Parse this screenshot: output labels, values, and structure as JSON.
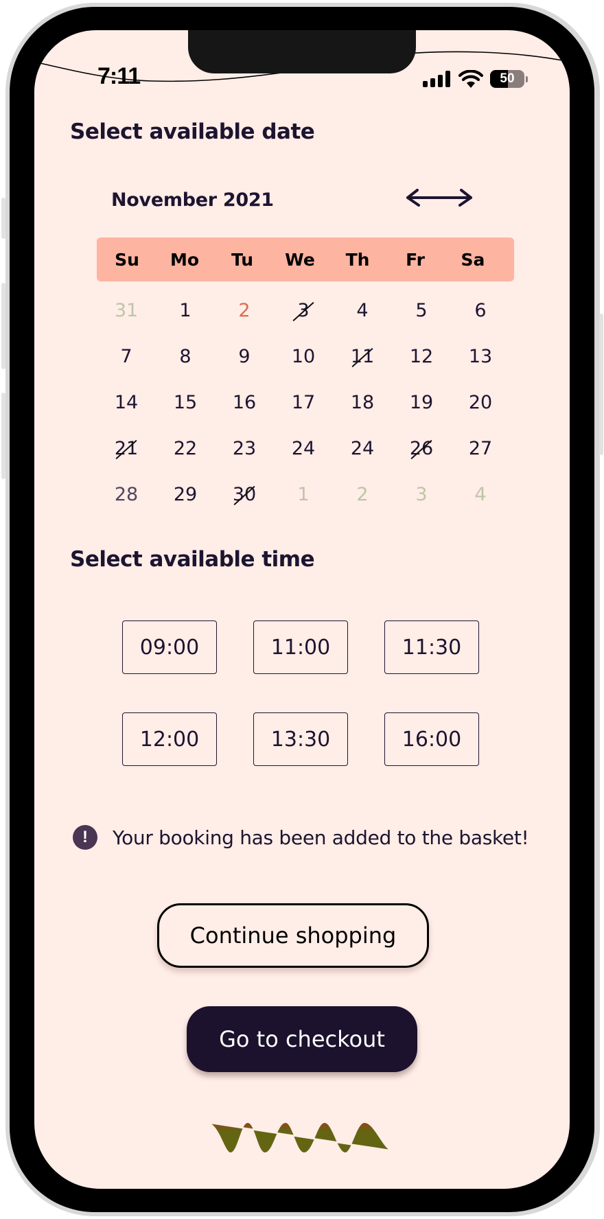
{
  "status_bar": {
    "time": "7:11",
    "battery_level": "50",
    "signal_icon": "cellular-signal-icon",
    "wifi_icon": "wifi-icon"
  },
  "date_section": {
    "title": "Select available date",
    "month_label": "November 2021",
    "nav_icon": "left-right-arrow-icon",
    "weekdays": [
      "Su",
      "Mo",
      "Tu",
      "We",
      "Th",
      "Fr",
      "Sa"
    ],
    "weeks": [
      [
        {
          "label": "31",
          "state": "muted"
        },
        {
          "label": "1",
          "state": "normal"
        },
        {
          "label": "2",
          "state": "today"
        },
        {
          "label": "3",
          "state": "unavailable"
        },
        {
          "label": "4",
          "state": "normal"
        },
        {
          "label": "5",
          "state": "normal"
        },
        {
          "label": "6",
          "state": "normal"
        }
      ],
      [
        {
          "label": "7",
          "state": "normal"
        },
        {
          "label": "8",
          "state": "normal"
        },
        {
          "label": "9",
          "state": "normal"
        },
        {
          "label": "10",
          "state": "normal"
        },
        {
          "label": "11",
          "state": "unavailable"
        },
        {
          "label": "12",
          "state": "normal"
        },
        {
          "label": "13",
          "state": "normal"
        }
      ],
      [
        {
          "label": "14",
          "state": "normal"
        },
        {
          "label": "15",
          "state": "normal"
        },
        {
          "label": "16",
          "state": "normal"
        },
        {
          "label": "17",
          "state": "normal"
        },
        {
          "label": "18",
          "state": "normal"
        },
        {
          "label": "19",
          "state": "normal"
        },
        {
          "label": "20",
          "state": "normal"
        }
      ],
      [
        {
          "label": "21",
          "state": "unavailable"
        },
        {
          "label": "22",
          "state": "normal"
        },
        {
          "label": "23",
          "state": "normal"
        },
        {
          "label": "24",
          "state": "normal"
        },
        {
          "label": "24",
          "state": "normal"
        },
        {
          "label": "26",
          "state": "unavailable"
        },
        {
          "label": "27",
          "state": "normal"
        }
      ],
      [
        {
          "label": "28",
          "state": "dim"
        },
        {
          "label": "29",
          "state": "normal"
        },
        {
          "label": "30",
          "state": "unavailable"
        },
        {
          "label": "1",
          "state": "muted"
        },
        {
          "label": "2",
          "state": "muted"
        },
        {
          "label": "3",
          "state": "muted"
        },
        {
          "label": "4",
          "state": "muted"
        }
      ]
    ]
  },
  "time_section": {
    "title": "Select available time",
    "slots": [
      "09:00",
      "11:00",
      "11:30",
      "12:00",
      "13:30",
      "16:00"
    ]
  },
  "notice": {
    "icon": "exclamation-icon",
    "text": "Your booking has been added to the basket!"
  },
  "actions": {
    "continue_label": "Continue shopping",
    "checkout_label": "Go to checkout"
  },
  "colors": {
    "background": "#ffede7",
    "weekday_bar": "#fdb4a0",
    "primary_dark": "#1c122e",
    "today": "#e06a4a",
    "muted_date": "#bfc5a7",
    "notice_icon": "#4a3553",
    "decoration": "#636512"
  }
}
